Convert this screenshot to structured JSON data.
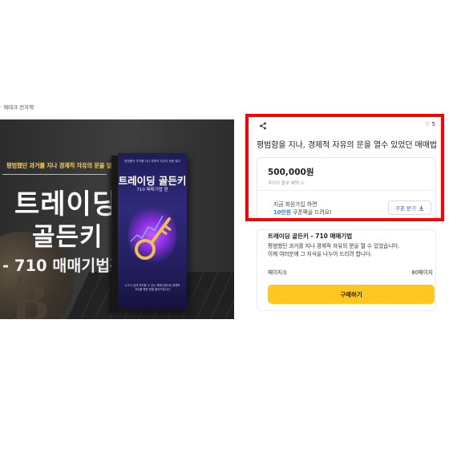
{
  "breadcrumb": "· 재테크 전자책",
  "banner": {
    "slogan": "평범했던 과거를 지나 경제적 자유의 문을 열다",
    "title_line1": "트레이딩",
    "title_line2": "골든키",
    "title_line3": "- 710 매매기법편",
    "book": {
      "subtitle": "평범했던 과거를 지나 경제적 자유의 문을 열다",
      "title": "트레이딩 골든키",
      "edition": "710 매매기법 편",
      "bottom_text": "누구나 쉽게 따라할 수 있는 매매기법으로 경제적 자유를 향한 문을 열어드립니다"
    }
  },
  "product": {
    "like_count": "5",
    "title": "평범함을 지나, 경제적 자유의 문을 열수 있었던 매매법",
    "price": "500,000원",
    "fee_note": "무이자 할부 혜택 ⊙",
    "promo_line1": "지금 회원가입 하면",
    "promo_highlight": "10만원",
    "promo_line2_rest": " 쿠폰팩을 드려요!",
    "coupon_label": "쿠폰 받기",
    "info_title": "트레이딩 골든키 - 710 매매기법",
    "info_desc1": "평범했던 과거를 지나 경제적 자유의 문을 열 수 있었습니다.",
    "info_desc2": "이제 여러분께 그 지식을 나누어 드리려 합니다.",
    "pages_label": "페이지수",
    "pages_value": "80페이지",
    "buy_label": "구매하기"
  },
  "colors": {
    "accent_yellow": "#ffc71f",
    "highlight_frame": "#ff0000",
    "promo_blue": "#2b7fe0"
  }
}
